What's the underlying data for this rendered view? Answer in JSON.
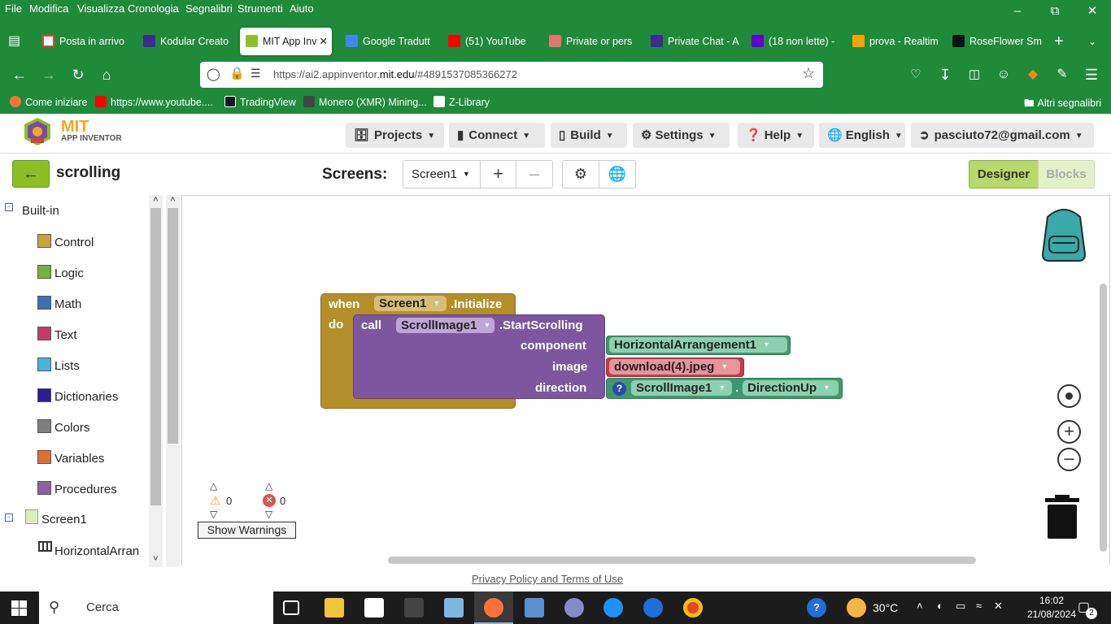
{
  "menubar": {
    "items": [
      "File",
      "Modifica",
      "Visualizza",
      "Cronologia",
      "Segnalibri",
      "Strumenti",
      "Aiuto"
    ]
  },
  "tabs": [
    {
      "label": "Posta in arrivo",
      "icon": "gmail-icon",
      "color": "#ea4335"
    },
    {
      "label": "Kodular Creato",
      "icon": "kodular-icon",
      "color": "#3d2a96"
    },
    {
      "label": "MIT App Inv",
      "icon": "mit-icon",
      "color": "#8cbf26",
      "active": true
    },
    {
      "label": "Google Tradutt",
      "icon": "translate-icon",
      "color": "#4285f4"
    },
    {
      "label": "(51) YouTube",
      "icon": "youtube-icon",
      "color": "#ff0000"
    },
    {
      "label": "Private or pers",
      "icon": "private-icon",
      "color": "#e57373"
    },
    {
      "label": "Private Chat - A",
      "icon": "kodular-chat-icon",
      "color": "#3d2a96"
    },
    {
      "label": "(18 non lette) -",
      "icon": "yahoo-mail-icon",
      "color": "#6001d2"
    },
    {
      "label": "prova - Realtim",
      "icon": "firebase-icon",
      "color": "#ffa000"
    },
    {
      "label": "RoseFlower Sm",
      "icon": "amazon-icon",
      "color": "#000000"
    }
  ],
  "navbar": {
    "url_prefix": "https://ai2.appinventor.",
    "url_domain": "mit.edu",
    "url_suffix": "/#4891537085366272"
  },
  "bookmarks": [
    {
      "label": "Come iniziare",
      "icon": "firefox-icon",
      "color": "#ff7139"
    },
    {
      "label": "https://www.youtube....",
      "icon": "youtube-icon",
      "color": "#ff0000"
    },
    {
      "label": "TradingView",
      "icon": "tradingview-icon",
      "color": "#131722"
    },
    {
      "label": "Monero (XMR) Mining...",
      "icon": "mining-icon",
      "color": "#444444"
    },
    {
      "label": "Z-Library",
      "icon": "zlibrary-icon",
      "color": "#ffffff"
    }
  ],
  "bookmarks_other": "Altri segnalibri",
  "app_header": {
    "logo_line1": "MIT",
    "logo_line2": "APP INVENTOR",
    "menus": [
      "Projects",
      "Connect",
      "Build",
      "Settings",
      "Help",
      "English"
    ],
    "account": "pasciuto72@gmail.com"
  },
  "project": {
    "name": "scrolling",
    "screens_label": "Screens:",
    "screen_selected": "Screen1",
    "designer_label": "Designer",
    "blocks_label": "Blocks"
  },
  "palette": {
    "builtin_label": "Built-in",
    "categories": [
      {
        "label": "Control",
        "color": "#c9a33c"
      },
      {
        "label": "Logic",
        "color": "#7cae3c"
      },
      {
        "label": "Math",
        "color": "#3c6fb4"
      },
      {
        "label": "Text",
        "color": "#c43c6a"
      },
      {
        "label": "Lists",
        "color": "#4ab3e0"
      },
      {
        "label": "Dictionaries",
        "color": "#2d1d94"
      },
      {
        "label": "Colors",
        "color": "#7f7f7f"
      },
      {
        "label": "Variables",
        "color": "#e06e2c"
      },
      {
        "label": "Procedures",
        "color": "#8f5fa4"
      }
    ],
    "screen_node": "Screen1",
    "component_node": "HorizontalArran"
  },
  "blocks": {
    "when": "when",
    "event_component": "Screen1",
    "event_name": ".Initialize",
    "do": "do",
    "call": "call",
    "method_component": "ScrollImage1",
    "method_name": ".StartScrolling",
    "param1": "component",
    "param2": "image",
    "param3": "direction",
    "arg_component": "HorizontalArrangement1",
    "arg_image": "download(4).jpeg",
    "arg_dir_component": "ScrollImage1",
    "arg_dir_dot": ".",
    "arg_dir_value": "DirectionUp",
    "help_glyph": "?"
  },
  "warnings": {
    "warning_count": "0",
    "error_count": "0",
    "button_label": "Show Warnings"
  },
  "footer": {
    "link": "Privacy Policy and Terms of Use"
  },
  "taskbar": {
    "search_placeholder": "Cerca",
    "weather": "30°C",
    "time": "16:02",
    "date": "21/08/2024",
    "notification_count": "2"
  }
}
